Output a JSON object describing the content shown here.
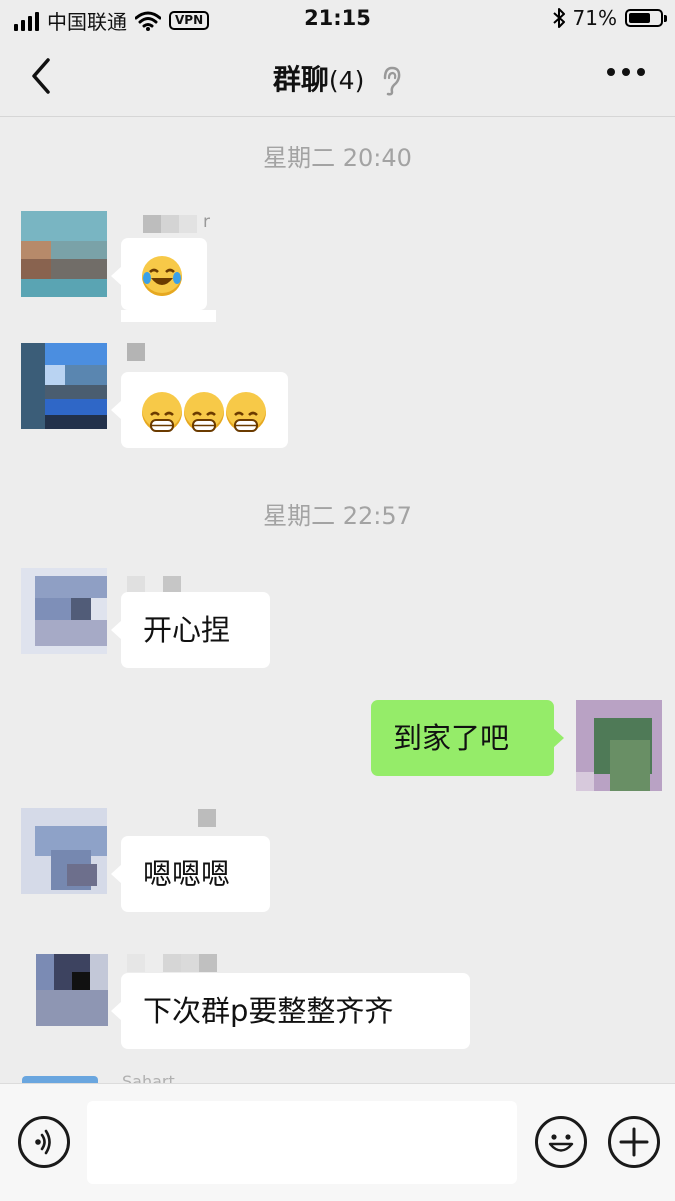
{
  "status_bar": {
    "carrier": "中国联通",
    "vpn": "VPN",
    "time": "21:15",
    "battery": "71%",
    "battery_level": 0.71
  },
  "header": {
    "title": "群聊",
    "member_count": "(4)",
    "icons": [
      "back-chevron-icon",
      "ear-icon",
      "more-dots-icon"
    ]
  },
  "chat": {
    "separators": [
      "星期二 20:40",
      "星期二 22:57"
    ],
    "messages": [
      {
        "side": "left",
        "nickname_fragment": "r",
        "content": "😂"
      },
      {
        "side": "left",
        "content": "😁😁😁"
      },
      {
        "side": "left",
        "content": "开心捏"
      },
      {
        "side": "right",
        "content": "到家了吧"
      },
      {
        "side": "left",
        "content": "嗯嗯嗯"
      },
      {
        "side": "left",
        "content": "下次群p要整整齐齐"
      }
    ],
    "partial_nickname": "Sahart"
  },
  "input_bar": {
    "placeholder": "",
    "icons": [
      "voice-icon",
      "emoji-icon",
      "plus-icon"
    ]
  },
  "colors": {
    "background": "#ededed",
    "sent_bubble": "#95ec69",
    "received_bubble": "#ffffff"
  }
}
